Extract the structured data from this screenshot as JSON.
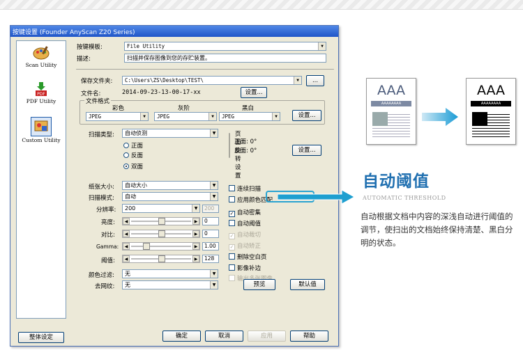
{
  "window": {
    "title": "按键设置 (Founder AnyScan Z20 Series)"
  },
  "sidebar": {
    "items": [
      {
        "label": "Scan Utility",
        "icon": "palette-icon"
      },
      {
        "label": "PDF Utility",
        "icon": "pdf-icon"
      },
      {
        "label": "Custom Utility",
        "icon": "custom-utility-icon"
      }
    ]
  },
  "form": {
    "template_label": "按键模板:",
    "template_value": "File Utility",
    "desc_label": "描述:",
    "desc_value": "扫描并保存图像到您的存贮装置。",
    "save_folder_label": "保存文件夹:",
    "save_folder_value": "C:\\Users\\ZS\\Desktop\\TEST\\",
    "browse_label": "...",
    "filename_label": "文件名:",
    "filename_value": "2014-09-23-13-00-17-xx",
    "settings_label": "设置...",
    "file_format_group": "文件格式",
    "color_label": "彩色",
    "gray_label": "灰阶",
    "bw_label": "黑白",
    "color_format": "JPEG",
    "gray_format": "JPEG",
    "bw_format": "JPEG",
    "scan_type_label": "扫描类型:",
    "scan_type_value": "自动侦测",
    "radio_front": "正面",
    "radio_back": "反面",
    "radio_duplex": "双面",
    "rotation_group": "页面旋转设置",
    "front_rotation": "正面: 0°",
    "back_rotation": "反面: 0°",
    "paper_size_label": "纸张大小:",
    "paper_size_value": "自动大小",
    "scan_mode_label": "扫描模式:",
    "scan_mode_value": "自动",
    "resolution_label": "分辨率:",
    "resolution_value": "200",
    "resolution_num": "200",
    "brightness_label": "亮度:",
    "brightness_value": "0",
    "contrast_label": "对比:",
    "contrast_value": "0",
    "gamma_label": "Gamma:",
    "gamma_value": "1.00",
    "threshold_label": "阈值:",
    "threshold_value": "128",
    "color_filter_label": "颜色过滤:",
    "color_filter_value": "无",
    "descreen_label": "去网纹:",
    "descreen_value": "无",
    "checkboxes": [
      {
        "label": "连续扫描",
        "checked": false,
        "disabled": false
      },
      {
        "label": "应用颜色匹配",
        "checked": false,
        "disabled": false
      },
      {
        "label": "自动密集",
        "checked": true,
        "disabled": false
      },
      {
        "label": "自动阈值",
        "checked": false,
        "disabled": false
      },
      {
        "label": "自动裁切",
        "checked": true,
        "disabled": true
      },
      {
        "label": "自动矫正",
        "checked": true,
        "disabled": true
      },
      {
        "label": "删除空白页",
        "checked": false,
        "disabled": false
      },
      {
        "label": "影像补边",
        "checked": false,
        "disabled": false
      },
      {
        "label": "输出多张图像",
        "checked": false,
        "disabled": true
      }
    ],
    "preview_label": "预览",
    "default_label": "默认值"
  },
  "footer": {
    "global_settings": "整体设定",
    "ok": "确定",
    "cancel": "取消",
    "apply": "应用",
    "help": "帮助"
  },
  "feature": {
    "doc_text": "AAA",
    "doc_band": "AAAAAAAA",
    "title": "自动阈值",
    "subtitle": "AUTOMATIC THRESHOLD",
    "description": "自动根据文档中内容的深浅自动进行阈值的调节，使扫出的文档始终保持清楚、黑白分明的状态。"
  },
  "colors": {
    "accent": "#1f6fb0",
    "highlight": "#29a3d1"
  }
}
